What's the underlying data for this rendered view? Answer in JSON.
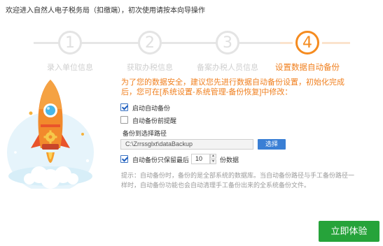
{
  "window": {
    "title": "欢迎进入自然人电子税务局（扣缴端），初次使用请按本向导操作"
  },
  "steps": [
    {
      "number": "1",
      "label": "录入单位信息",
      "active": false
    },
    {
      "number": "2",
      "label": "获取办税信息",
      "active": false
    },
    {
      "number": "3",
      "label": "备案办税人员信息",
      "active": false
    },
    {
      "number": "4",
      "label": "设置数据自动备份",
      "active": true
    }
  ],
  "backup": {
    "intro": "为了您的数据安全，建议您先进行数据自动备份设置，初始化完成后，您可在[系统设置-系统管理-备份恢复]中修改：",
    "auto_backup_label": "启动自动备份",
    "auto_backup_checked": true,
    "remind_label": "自动备份前提醒",
    "remind_checked": false,
    "path_label": "备份到选择路径",
    "path_value": "C:\\Zrrssglxt\\dataBackup",
    "browse_label": "选择",
    "keep_prefix": "自动备份只保留最后",
    "keep_checked": true,
    "keep_count": "10",
    "keep_suffix": "份数据",
    "hint": "提示：自动备份时，备份的是全部系统的数据库。当自动备份路径与手工备份路径一样时，自动备份功能也会自动清理手工备份出来的全系统备份文件。"
  },
  "actions": {
    "start_label": "立即体验"
  },
  "colors": {
    "accent": "#f58b1f",
    "button_blue": "#3a7fd5",
    "button_green": "#26a33a"
  },
  "icons": {
    "rocket": "rocket-illustration",
    "gear": "gear-icon"
  }
}
